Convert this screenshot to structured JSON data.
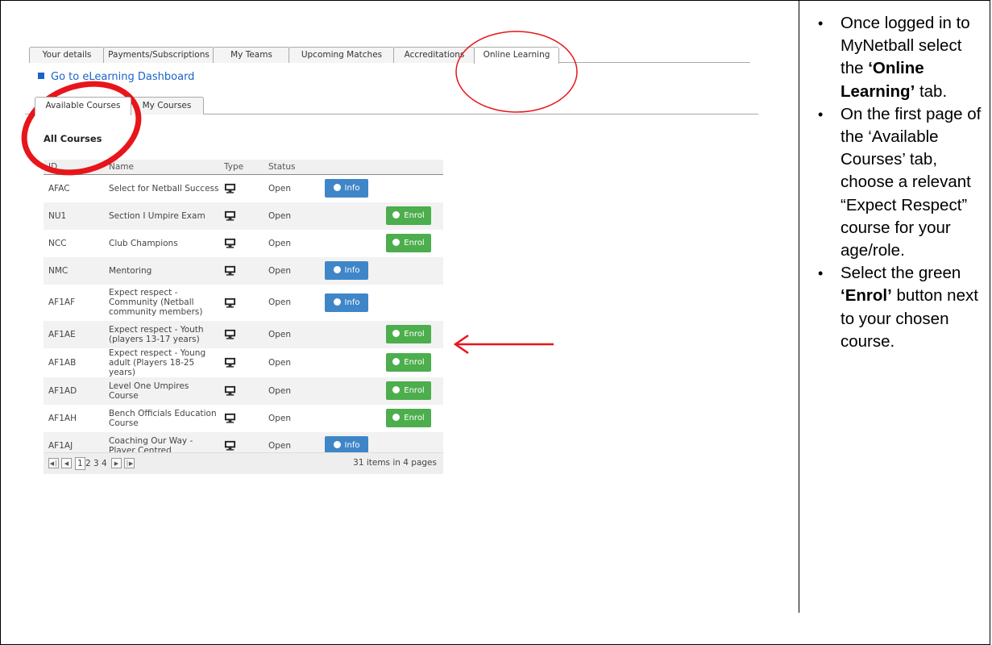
{
  "main_tabs": [
    {
      "label": "Your details",
      "active": false
    },
    {
      "label": "Payments/Subscriptions",
      "active": false
    },
    {
      "label": "My Teams",
      "active": false
    },
    {
      "label": "Upcoming Matches",
      "active": false
    },
    {
      "label": "Accreditations",
      "active": false
    },
    {
      "label": "Online Learning",
      "active": true
    }
  ],
  "elearning_link": "Go to eLearning Dashboard",
  "sub_tabs": [
    {
      "label": "Available Courses",
      "active": true
    },
    {
      "label": "My Courses",
      "active": false
    }
  ],
  "section_title": "All Courses",
  "table": {
    "headers": [
      "ID",
      "Name",
      "Type",
      "Status"
    ],
    "rows": [
      {
        "id": "AFAC",
        "name": "Select for Netball Success",
        "type_icon": "monitor-icon",
        "status": "Open",
        "action": "Info"
      },
      {
        "id": "NU1",
        "name": "Section I Umpire Exam",
        "type_icon": "monitor-icon",
        "status": "Open",
        "action": "Enrol"
      },
      {
        "id": "NCC",
        "name": "Club Champions",
        "type_icon": "monitor-icon",
        "status": "Open",
        "action": "Enrol"
      },
      {
        "id": "NMC",
        "name": "Mentoring",
        "type_icon": "monitor-icon",
        "status": "Open",
        "action": "Info"
      },
      {
        "id": "AF1AF",
        "name": "Expect respect - Community (Netball community members)",
        "type_icon": "monitor-icon",
        "status": "Open",
        "action": "Info"
      },
      {
        "id": "AF1AE",
        "name": "Expect respect - Youth (players 13-17 years)",
        "type_icon": "monitor-icon",
        "status": "Open",
        "action": "Enrol"
      },
      {
        "id": "AF1AB",
        "name": "Expect respect - Young adult (Players 18-25 years)",
        "type_icon": "monitor-icon",
        "status": "Open",
        "action": "Enrol"
      },
      {
        "id": "AF1AD",
        "name": "Level One Umpires Course",
        "type_icon": "monitor-icon",
        "status": "Open",
        "action": "Enrol"
      },
      {
        "id": "AF1AH",
        "name": "Bench Officials Education Course",
        "type_icon": "monitor-icon",
        "status": "Open",
        "action": "Enrol"
      },
      {
        "id": "AF1AJ",
        "name": "Coaching Our Way - Player Centred",
        "type_icon": "monitor-icon",
        "status": "Open",
        "action": "Info"
      }
    ]
  },
  "pager": {
    "pages": [
      "1",
      "2",
      "3",
      "4"
    ],
    "current": "1",
    "summary": "31 items in 4 pages"
  },
  "colors": {
    "info_button": "#3f86c8",
    "enrol_button": "#4cae4c",
    "annotation": "#e8151b",
    "link": "#1a64c8"
  },
  "instructions": [
    {
      "parts": [
        {
          "text": "Once logged in to MyNetball select the ",
          "bold": false
        },
        {
          "text": "‘Online Learning’",
          "bold": true
        },
        {
          "text": " tab.",
          "bold": false
        }
      ]
    },
    {
      "parts": [
        {
          "text": "On the first page of the ‘Available Courses’ tab, choose a relevant “Expect Respect” course for your age/role.",
          "bold": false
        }
      ]
    },
    {
      "parts": [
        {
          "text": "Select the green ",
          "bold": false
        },
        {
          "text": "‘Enrol’",
          "bold": true
        },
        {
          "text": " button next to your chosen course.",
          "bold": false
        }
      ]
    }
  ]
}
